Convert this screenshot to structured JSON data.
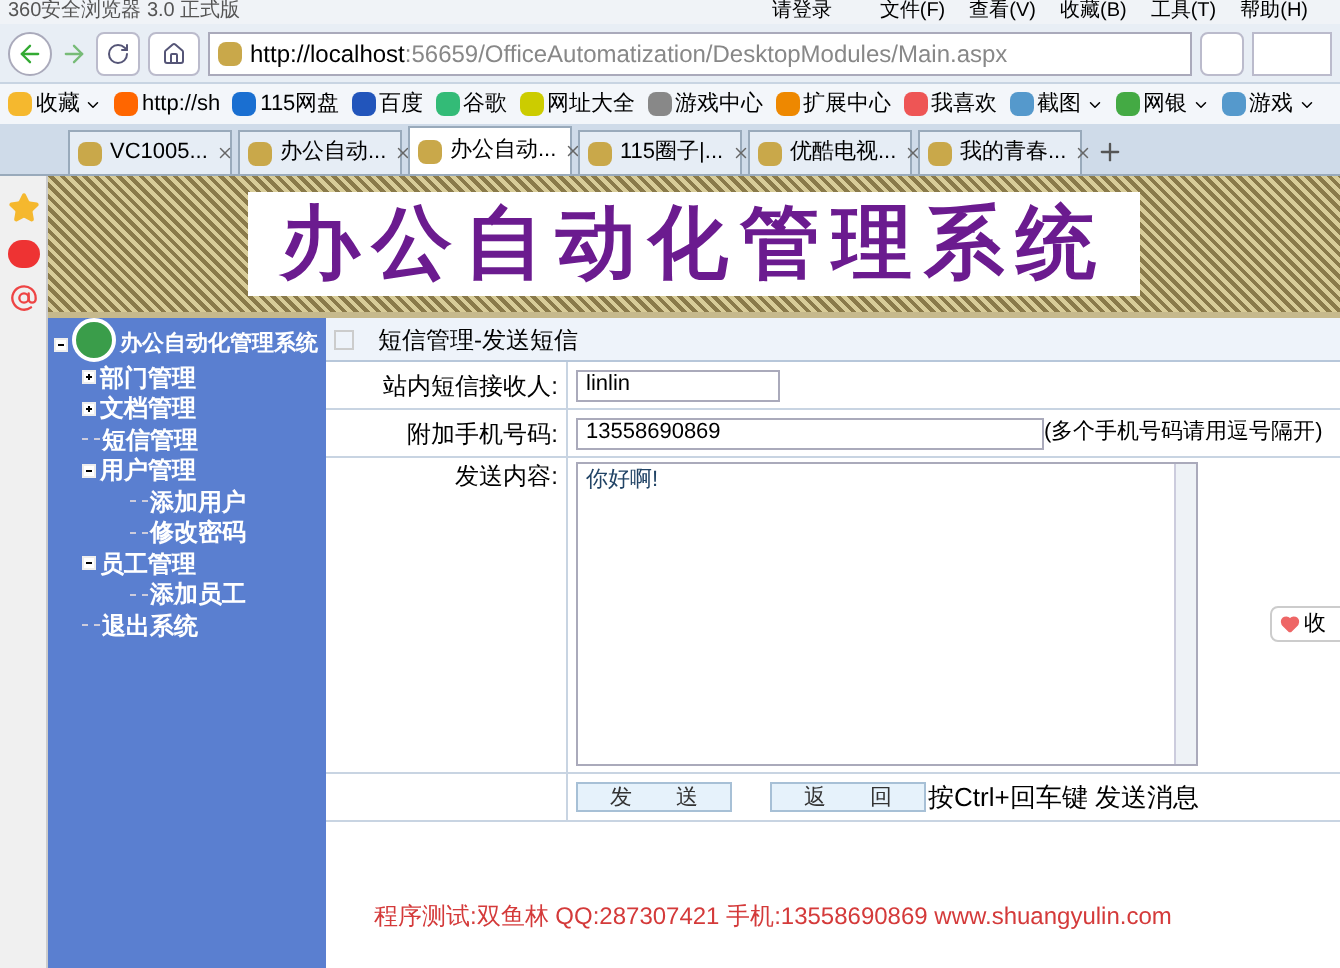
{
  "window": {
    "title": "360安全浏览器 3.0 正式版",
    "login": "请登录",
    "menu": [
      "文件(F)",
      "查看(V)",
      "收藏(B)",
      "工具(T)",
      "帮助(H)"
    ]
  },
  "address": {
    "url_host": "http://localhost",
    "url_rest": ":56659/OfficeAutomatization/DesktopModules/Main.aspx"
  },
  "bookmarks": [
    {
      "label": "收藏",
      "dropdown": true
    },
    {
      "label": "http://sh",
      "dropdown": false
    },
    {
      "label": "115网盘",
      "dropdown": false
    },
    {
      "label": "百度",
      "dropdown": false
    },
    {
      "label": "谷歌",
      "dropdown": false
    },
    {
      "label": "网址大全",
      "dropdown": false
    },
    {
      "label": "游戏中心",
      "dropdown": false
    },
    {
      "label": "扩展中心",
      "dropdown": false
    },
    {
      "label": "我喜欢",
      "dropdown": false
    },
    {
      "label": "截图",
      "dropdown": true
    },
    {
      "label": "网银",
      "dropdown": true
    },
    {
      "label": "游戏",
      "dropdown": true
    }
  ],
  "tabs": [
    {
      "label": "VC1005...",
      "selected": false
    },
    {
      "label": "办公自动...",
      "selected": false
    },
    {
      "label": "办公自动...",
      "selected": true
    },
    {
      "label": "115圈子|...",
      "selected": false
    },
    {
      "label": "优酷电视...",
      "selected": false
    },
    {
      "label": "我的青春...",
      "selected": false
    }
  ],
  "banner": {
    "title": "办公自动化管理系统"
  },
  "tree": {
    "label": "办公自动化管理系统",
    "expanded": true,
    "children": [
      {
        "label": "部门管理",
        "expanded": false
      },
      {
        "label": "文档管理",
        "expanded": false
      },
      {
        "label": "短信管理"
      },
      {
        "label": "用户管理",
        "expanded": true,
        "children": [
          {
            "label": "添加用户"
          },
          {
            "label": "修改密码"
          }
        ]
      },
      {
        "label": "员工管理",
        "expanded": true,
        "children": [
          {
            "label": "添加员工"
          }
        ]
      },
      {
        "label": "退出系统"
      }
    ]
  },
  "panel": {
    "title": "短信管理-发送短信"
  },
  "form": {
    "recipient_label": "站内短信接收人:",
    "recipient": "linlin",
    "phone_label": "附加手机号码:",
    "phone": "13558690869",
    "phone_hint": "(多个手机号码请用逗号隔开)",
    "content_label": "发送内容:",
    "content": "你好啊!"
  },
  "buttons": [
    "发　　送",
    "返　　回"
  ],
  "shortcut_hint": "按Ctrl+回车键 发送消息",
  "footer": "程序测试:双鱼林 QQ:287307421 手机:13558690869 www.shuangyulin.com",
  "float_button": "收"
}
